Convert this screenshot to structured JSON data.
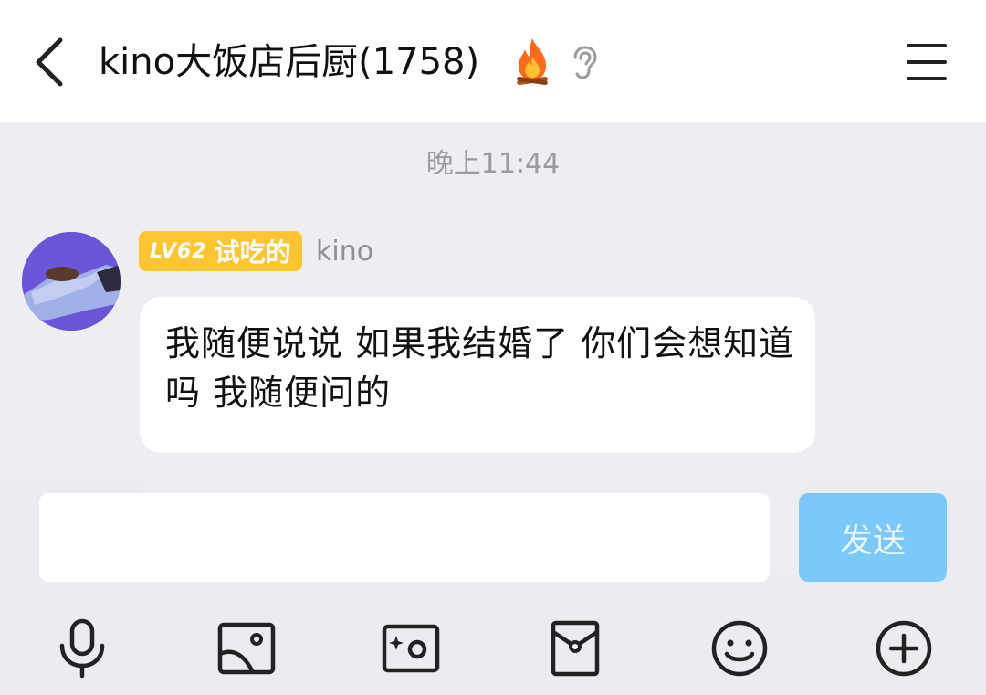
{
  "header": {
    "title": "kino大饭店后厨(1758)",
    "icons": [
      "back-icon",
      "fire-icon",
      "ear-icon",
      "menu-icon"
    ]
  },
  "chat": {
    "timestamp": "晚上11:44",
    "messages": [
      {
        "level": "LV62",
        "rank": "试吃的",
        "sender": "kino",
        "text": "我随便说说 如果我结婚了 你们会想知道吗 我随便问的"
      }
    ]
  },
  "composer": {
    "input_value": "",
    "send_label": "发送",
    "tools": [
      "microphone-icon",
      "image-icon",
      "camera-icon",
      "red-packet-icon",
      "emoji-icon",
      "plus-icon"
    ]
  },
  "colors": {
    "background": "#ededf2",
    "badge": "#ffc531",
    "send_button": "#7cc9f9",
    "avatar": "#6d56d8"
  }
}
